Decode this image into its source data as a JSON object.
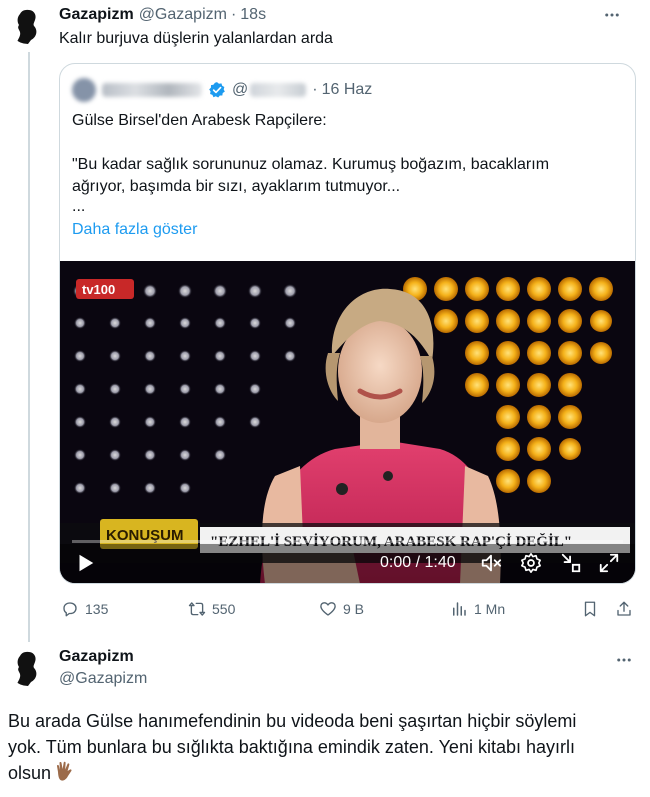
{
  "tweet1": {
    "display_name": "Gazapizm",
    "handle": "@Gazapizm",
    "separator": "·",
    "time": "18s",
    "text": "Kalır burjuva düşlerin yalanlardan arda",
    "avatar_icon": "silhouette-avatar-icon",
    "more_icon": "more-horizontal-icon"
  },
  "quote": {
    "handle_prefix": "@",
    "separator": "·",
    "date": "16 Haz",
    "verified_color": "#1d9bf0",
    "lines": [
      "Gülse Birsel'den Arabesk Rapçilere:",
      "\"Bu kadar sağlık sorununuz olamaz. Kurumuş boğazım, bacaklarım",
      "ağrıyor, başımda bir sızı, ayaklarım tutmuyor...",
      "..."
    ],
    "show_more": "Daha fazla göster"
  },
  "video": {
    "channel_logo": "tv100",
    "show_logo": "KONUŞUM",
    "caption": "\"EZHEL'İ SEVİYORUM, ARABESK RAP'Çİ DEĞİL\"",
    "current_time": "0:00",
    "time_separator": " / ",
    "duration": "1:40",
    "progress": 0,
    "icons": [
      "play-icon",
      "volume-muted-icon",
      "settings-gear-icon",
      "minimize-icon",
      "fullscreen-icon"
    ]
  },
  "actions": {
    "replies": "135",
    "reposts": "550",
    "likes": "9 B",
    "views": "1 Mn"
  },
  "tweet2": {
    "display_name": "Gazapizm",
    "handle": "@Gazapizm",
    "lines": [
      "Bu arada Gülse hanımefendinin bu videoda beni şaşırtan hiçbir söylemi",
      "yok. Tüm bunlara bu sığlıkta baktığına emindik zaten. Yeni kitabı hayırlı",
      "olsun"
    ],
    "emoji": "vulcan-salute-emoji"
  },
  "colors": {
    "accent": "#1d9bf0",
    "text_primary": "#0f1419",
    "text_secondary": "#536471",
    "border": "#cfd9de"
  }
}
